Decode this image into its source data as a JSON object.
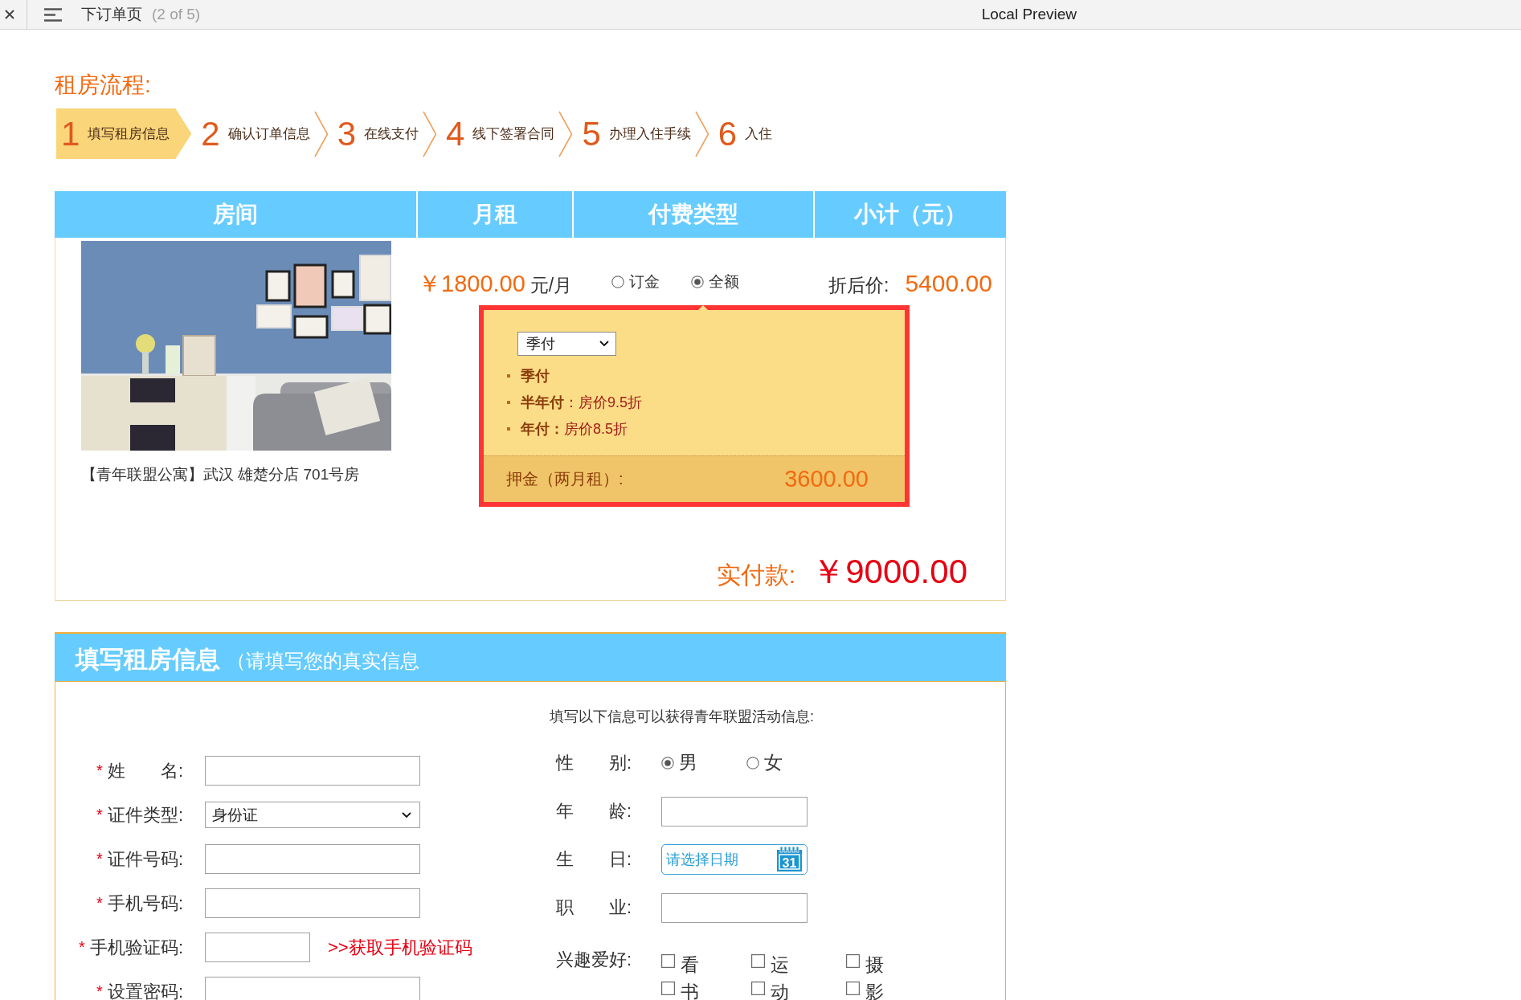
{
  "tab_bar": {
    "title": "下订单页",
    "counter": "(2 of 5)",
    "preview_title": "Local Preview"
  },
  "process": {
    "title": "租房流程:",
    "steps": [
      {
        "number": "1",
        "label": "填写租房信息",
        "selected": true
      },
      {
        "number": "2",
        "label": "确认订单信息",
        "selected": false
      },
      {
        "number": "3",
        "label": "在线支付",
        "selected": false
      },
      {
        "number": "4",
        "label": "线下签署合同",
        "selected": false
      },
      {
        "number": "5",
        "label": "办理入住手续",
        "selected": false
      },
      {
        "number": "6",
        "label": "入住",
        "selected": false
      }
    ]
  },
  "order_table": {
    "columns": [
      "房间",
      "月租",
      "付费类型",
      "小计（元）"
    ],
    "room_caption": "【青年联盟公寓】武汉 雄楚分店 701号房",
    "rent": {
      "amount": "￥1800.00",
      "unit": "元/月"
    },
    "payment_types": [
      {
        "label": "订金",
        "selected": false
      },
      {
        "label": "全额",
        "selected": true
      }
    ],
    "subtotal": {
      "label": "折后价:",
      "amount": "5400.00"
    },
    "payment_popup": {
      "period_select": {
        "value": "季付"
      },
      "options": [
        {
          "term": "季付"
        },
        {
          "term": "半年付",
          "detail": "：房价9.5折"
        },
        {
          "term": "年付：",
          "detail": "房价8.5折"
        }
      ],
      "deposit": {
        "label": "押金（两月租）:",
        "amount": "3600.00"
      }
    },
    "total": {
      "label": "实付款:",
      "amount": "￥9000.00"
    }
  },
  "form": {
    "title": "填写租房信息",
    "subtitle": "（请填写您的真实信息",
    "intro": "填写以下信息可以获得青年联盟活动信息:",
    "left_fields": [
      {
        "kind": "text",
        "marker": "*",
        "label": "姓　　名:"
      },
      {
        "kind": "select",
        "marker": "*",
        "label": "证件类型:",
        "value": "身份证"
      },
      {
        "kind": "text",
        "marker": "*",
        "label": "证件号码:"
      },
      {
        "kind": "text",
        "marker": "*",
        "label": "手机号码:"
      },
      {
        "kind": "code",
        "marker": "*",
        "label": "手机验证码:",
        "link": ">>获取手机验证码"
      },
      {
        "kind": "text",
        "marker": "*",
        "label": "设置密码:"
      }
    ],
    "right_fields": [
      {
        "kind": "radio",
        "label": "性　　别:",
        "options": [
          {
            "label": "男",
            "selected": true
          },
          {
            "label": "女",
            "selected": false
          }
        ]
      },
      {
        "kind": "text",
        "label": "年　　龄:"
      },
      {
        "kind": "date",
        "label": "生　　日:",
        "placeholder": "请选择日期",
        "icon_text": "31"
      },
      {
        "kind": "text",
        "label": "职　　业:"
      },
      {
        "kind": "checkboxes",
        "label": "兴趣爱好:",
        "options": [
          {
            "label": "看书",
            "checked": false
          },
          {
            "label": "运动",
            "checked": false
          },
          {
            "label": "摄影",
            "checked": false
          },
          {
            "checked": false
          },
          {
            "checked": false
          },
          {
            "checked": false
          }
        ]
      }
    ]
  }
}
